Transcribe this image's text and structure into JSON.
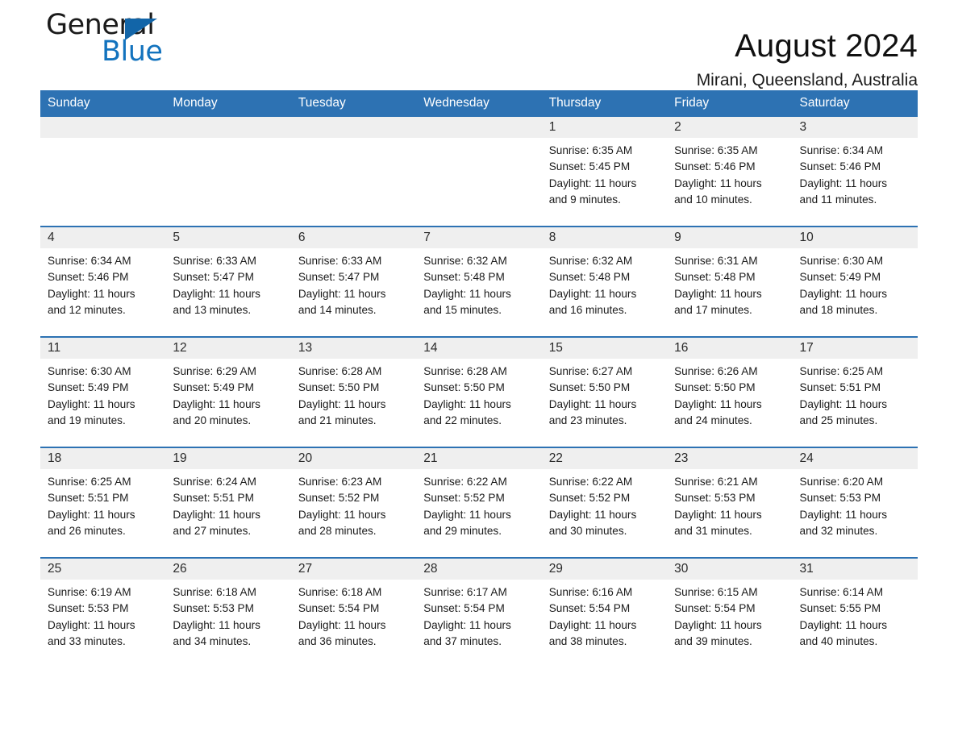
{
  "brand": {
    "line1": "General",
    "line2": "Blue",
    "logo_blue": "#1373BE",
    "triangle_blue": "#1265A8"
  },
  "header": {
    "month_title": "August 2024",
    "location": "Mirani, Queensland, Australia",
    "accent_color": "#2D72B3",
    "daynum_band_color": "#efefef"
  },
  "weekday_headers": [
    "Sunday",
    "Monday",
    "Tuesday",
    "Wednesday",
    "Thursday",
    "Friday",
    "Saturday"
  ],
  "weeks": [
    [
      {
        "day": "",
        "sunrise": "",
        "sunset": "",
        "daylight_l1": "",
        "daylight_l2": ""
      },
      {
        "day": "",
        "sunrise": "",
        "sunset": "",
        "daylight_l1": "",
        "daylight_l2": ""
      },
      {
        "day": "",
        "sunrise": "",
        "sunset": "",
        "daylight_l1": "",
        "daylight_l2": ""
      },
      {
        "day": "",
        "sunrise": "",
        "sunset": "",
        "daylight_l1": "",
        "daylight_l2": ""
      },
      {
        "day": "1",
        "sunrise": "Sunrise: 6:35 AM",
        "sunset": "Sunset: 5:45 PM",
        "daylight_l1": "Daylight: 11 hours",
        "daylight_l2": "and 9 minutes."
      },
      {
        "day": "2",
        "sunrise": "Sunrise: 6:35 AM",
        "sunset": "Sunset: 5:46 PM",
        "daylight_l1": "Daylight: 11 hours",
        "daylight_l2": "and 10 minutes."
      },
      {
        "day": "3",
        "sunrise": "Sunrise: 6:34 AM",
        "sunset": "Sunset: 5:46 PM",
        "daylight_l1": "Daylight: 11 hours",
        "daylight_l2": "and 11 minutes."
      }
    ],
    [
      {
        "day": "4",
        "sunrise": "Sunrise: 6:34 AM",
        "sunset": "Sunset: 5:46 PM",
        "daylight_l1": "Daylight: 11 hours",
        "daylight_l2": "and 12 minutes."
      },
      {
        "day": "5",
        "sunrise": "Sunrise: 6:33 AM",
        "sunset": "Sunset: 5:47 PM",
        "daylight_l1": "Daylight: 11 hours",
        "daylight_l2": "and 13 minutes."
      },
      {
        "day": "6",
        "sunrise": "Sunrise: 6:33 AM",
        "sunset": "Sunset: 5:47 PM",
        "daylight_l1": "Daylight: 11 hours",
        "daylight_l2": "and 14 minutes."
      },
      {
        "day": "7",
        "sunrise": "Sunrise: 6:32 AM",
        "sunset": "Sunset: 5:48 PM",
        "daylight_l1": "Daylight: 11 hours",
        "daylight_l2": "and 15 minutes."
      },
      {
        "day": "8",
        "sunrise": "Sunrise: 6:32 AM",
        "sunset": "Sunset: 5:48 PM",
        "daylight_l1": "Daylight: 11 hours",
        "daylight_l2": "and 16 minutes."
      },
      {
        "day": "9",
        "sunrise": "Sunrise: 6:31 AM",
        "sunset": "Sunset: 5:48 PM",
        "daylight_l1": "Daylight: 11 hours",
        "daylight_l2": "and 17 minutes."
      },
      {
        "day": "10",
        "sunrise": "Sunrise: 6:30 AM",
        "sunset": "Sunset: 5:49 PM",
        "daylight_l1": "Daylight: 11 hours",
        "daylight_l2": "and 18 minutes."
      }
    ],
    [
      {
        "day": "11",
        "sunrise": "Sunrise: 6:30 AM",
        "sunset": "Sunset: 5:49 PM",
        "daylight_l1": "Daylight: 11 hours",
        "daylight_l2": "and 19 minutes."
      },
      {
        "day": "12",
        "sunrise": "Sunrise: 6:29 AM",
        "sunset": "Sunset: 5:49 PM",
        "daylight_l1": "Daylight: 11 hours",
        "daylight_l2": "and 20 minutes."
      },
      {
        "day": "13",
        "sunrise": "Sunrise: 6:28 AM",
        "sunset": "Sunset: 5:50 PM",
        "daylight_l1": "Daylight: 11 hours",
        "daylight_l2": "and 21 minutes."
      },
      {
        "day": "14",
        "sunrise": "Sunrise: 6:28 AM",
        "sunset": "Sunset: 5:50 PM",
        "daylight_l1": "Daylight: 11 hours",
        "daylight_l2": "and 22 minutes."
      },
      {
        "day": "15",
        "sunrise": "Sunrise: 6:27 AM",
        "sunset": "Sunset: 5:50 PM",
        "daylight_l1": "Daylight: 11 hours",
        "daylight_l2": "and 23 minutes."
      },
      {
        "day": "16",
        "sunrise": "Sunrise: 6:26 AM",
        "sunset": "Sunset: 5:50 PM",
        "daylight_l1": "Daylight: 11 hours",
        "daylight_l2": "and 24 minutes."
      },
      {
        "day": "17",
        "sunrise": "Sunrise: 6:25 AM",
        "sunset": "Sunset: 5:51 PM",
        "daylight_l1": "Daylight: 11 hours",
        "daylight_l2": "and 25 minutes."
      }
    ],
    [
      {
        "day": "18",
        "sunrise": "Sunrise: 6:25 AM",
        "sunset": "Sunset: 5:51 PM",
        "daylight_l1": "Daylight: 11 hours",
        "daylight_l2": "and 26 minutes."
      },
      {
        "day": "19",
        "sunrise": "Sunrise: 6:24 AM",
        "sunset": "Sunset: 5:51 PM",
        "daylight_l1": "Daylight: 11 hours",
        "daylight_l2": "and 27 minutes."
      },
      {
        "day": "20",
        "sunrise": "Sunrise: 6:23 AM",
        "sunset": "Sunset: 5:52 PM",
        "daylight_l1": "Daylight: 11 hours",
        "daylight_l2": "and 28 minutes."
      },
      {
        "day": "21",
        "sunrise": "Sunrise: 6:22 AM",
        "sunset": "Sunset: 5:52 PM",
        "daylight_l1": "Daylight: 11 hours",
        "daylight_l2": "and 29 minutes."
      },
      {
        "day": "22",
        "sunrise": "Sunrise: 6:22 AM",
        "sunset": "Sunset: 5:52 PM",
        "daylight_l1": "Daylight: 11 hours",
        "daylight_l2": "and 30 minutes."
      },
      {
        "day": "23",
        "sunrise": "Sunrise: 6:21 AM",
        "sunset": "Sunset: 5:53 PM",
        "daylight_l1": "Daylight: 11 hours",
        "daylight_l2": "and 31 minutes."
      },
      {
        "day": "24",
        "sunrise": "Sunrise: 6:20 AM",
        "sunset": "Sunset: 5:53 PM",
        "daylight_l1": "Daylight: 11 hours",
        "daylight_l2": "and 32 minutes."
      }
    ],
    [
      {
        "day": "25",
        "sunrise": "Sunrise: 6:19 AM",
        "sunset": "Sunset: 5:53 PM",
        "daylight_l1": "Daylight: 11 hours",
        "daylight_l2": "and 33 minutes."
      },
      {
        "day": "26",
        "sunrise": "Sunrise: 6:18 AM",
        "sunset": "Sunset: 5:53 PM",
        "daylight_l1": "Daylight: 11 hours",
        "daylight_l2": "and 34 minutes."
      },
      {
        "day": "27",
        "sunrise": "Sunrise: 6:18 AM",
        "sunset": "Sunset: 5:54 PM",
        "daylight_l1": "Daylight: 11 hours",
        "daylight_l2": "and 36 minutes."
      },
      {
        "day": "28",
        "sunrise": "Sunrise: 6:17 AM",
        "sunset": "Sunset: 5:54 PM",
        "daylight_l1": "Daylight: 11 hours",
        "daylight_l2": "and 37 minutes."
      },
      {
        "day": "29",
        "sunrise": "Sunrise: 6:16 AM",
        "sunset": "Sunset: 5:54 PM",
        "daylight_l1": "Daylight: 11 hours",
        "daylight_l2": "and 38 minutes."
      },
      {
        "day": "30",
        "sunrise": "Sunrise: 6:15 AM",
        "sunset": "Sunset: 5:54 PM",
        "daylight_l1": "Daylight: 11 hours",
        "daylight_l2": "and 39 minutes."
      },
      {
        "day": "31",
        "sunrise": "Sunrise: 6:14 AM",
        "sunset": "Sunset: 5:55 PM",
        "daylight_l1": "Daylight: 11 hours",
        "daylight_l2": "and 40 minutes."
      }
    ]
  ]
}
